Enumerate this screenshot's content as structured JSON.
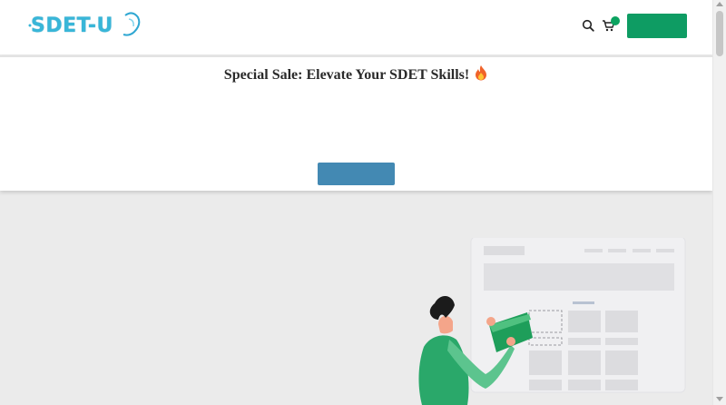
{
  "header": {
    "logo_text": "SDET-U",
    "icons": [
      "search-icon",
      "cart-icon"
    ],
    "cta_label": "",
    "brand_color": "#38b6d8",
    "cta_color": "#0e9c63"
  },
  "promo": {
    "title": "Special Sale: Elevate Your SDET Skills!",
    "emoji_icon": "fire-icon",
    "button_label": "",
    "button_color": "#4389b3"
  },
  "hero": {
    "illustration": "person-holding-card-with-dashboard-illustration",
    "background_color": "#ebebeb"
  }
}
